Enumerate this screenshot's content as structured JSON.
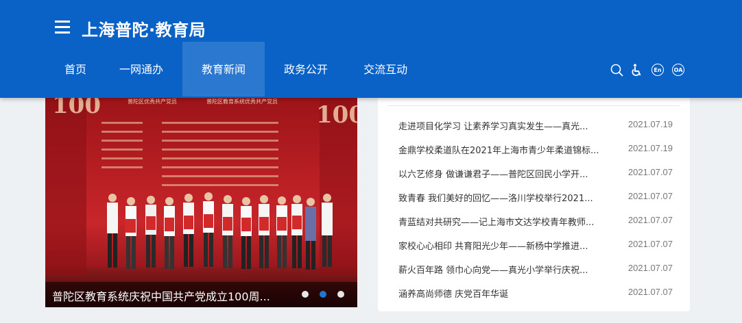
{
  "header": {
    "title": "上海普陀·教育局",
    "nav": [
      {
        "label": "首页"
      },
      {
        "label": "一网通办"
      },
      {
        "label": "教育新闻"
      },
      {
        "label": "政务公开"
      },
      {
        "label": "交流互动"
      }
    ],
    "active_nav": "教育新闻",
    "tools": {
      "english_label": "En",
      "oa_label": "OA"
    },
    "colors": {
      "bar": "#0a62c7",
      "active_tab": "#2a78cf"
    }
  },
  "carousel": {
    "caption": "普陀区教育系统庆祝中国共产党成立100周...",
    "slide_count": 3,
    "active_slide": 2,
    "photo_texts": {
      "banner_left": "普陀区优秀共产党员",
      "banner_right": "普陀区教育系统优秀共产党员"
    },
    "colors": {
      "stage": "#b5181f",
      "active_dot": "#1d77d4"
    }
  },
  "news": {
    "items": [
      {
        "title": "走进项目化学习 让素养学习真实发生——真光...",
        "date": "2021.07.19"
      },
      {
        "title": "金鼎学校柔道队在2021年上海市青少年柔道锦标...",
        "date": "2021.07.19"
      },
      {
        "title": "以六艺修身 做谦谦君子——普陀区回民小学开...",
        "date": "2021.07.07"
      },
      {
        "title": "致青春 我们美好的回忆——洛川学校举行2021...",
        "date": "2021.07.07"
      },
      {
        "title": "青蓝结对共研究——记上海市文达学校青年教师...",
        "date": "2021.07.07"
      },
      {
        "title": "家校心心相印 共育阳光少年——新杨中学推进...",
        "date": "2021.07.07"
      },
      {
        "title": "薪火百年路 领巾心向党——真光小学举行庆祝...",
        "date": "2021.07.07"
      },
      {
        "title": "涵养高尚师德 庆党百年华诞",
        "date": "2021.07.07"
      }
    ]
  }
}
